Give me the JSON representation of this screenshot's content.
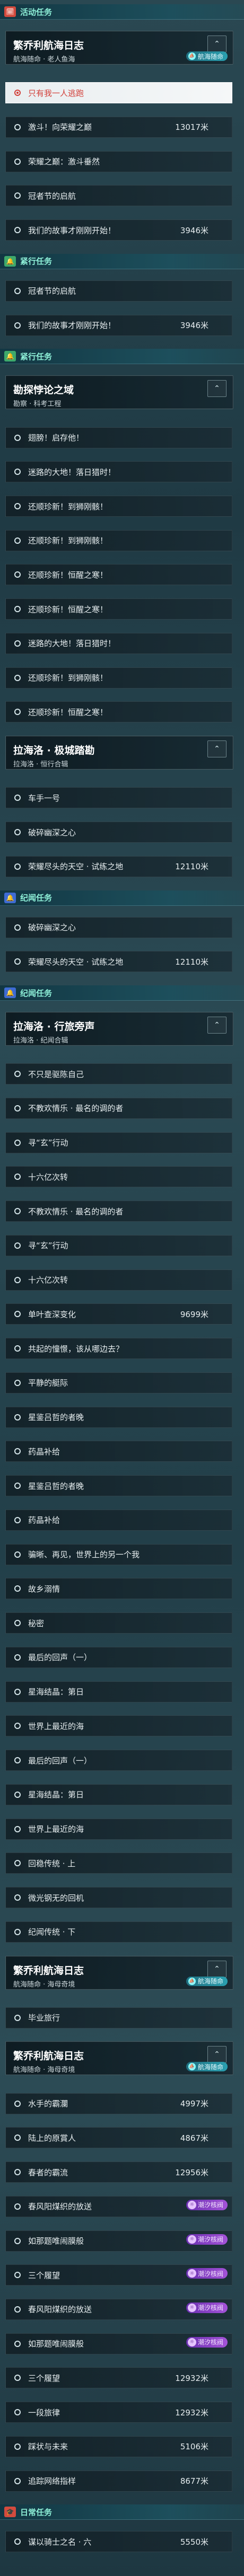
{
  "icons": {
    "activity": "calendar-icon",
    "urgent": "bell-icon",
    "chevron": "chevron-up-icon",
    "ring": "radio-ring-icon",
    "ferry": "ferry-icon",
    "dawn": "sunrise-icon"
  },
  "colors": {
    "activity_tag": "#d34b3e",
    "urgent_tag": "#3ea96b",
    "discipline_tag": "#3e6bd3",
    "selected_text": "#d2403a"
  },
  "items": [
    {
      "kind": "section",
      "icon_text": "🗓",
      "label": "活动任务",
      "tag": "activity"
    },
    {
      "kind": "card",
      "title": "繁乔利航海日志",
      "sub": "航海随命 · 老人鱼海",
      "chev": "⌃",
      "badge": "航海随命"
    },
    {
      "kind": "row",
      "title": "只有我一人逃跑",
      "selected": true
    },
    {
      "kind": "row",
      "title": "激斗！向荣耀之巅",
      "dist": "13017米"
    },
    {
      "kind": "row",
      "title": "荣耀之巅：激斗垂然"
    },
    {
      "kind": "row",
      "title": "冠者节的启航"
    },
    {
      "kind": "row",
      "title": "我们的故事才刚刚开始！",
      "dist": "3946米"
    },
    {
      "kind": "section",
      "icon_text": "🔔",
      "label": "紧行任务",
      "tag": "urgent"
    },
    {
      "kind": "row",
      "title": "冠者节的启航"
    },
    {
      "kind": "row",
      "title": "我们的故事才刚刚开始！",
      "dist": "3946米"
    },
    {
      "kind": "section",
      "icon_text": "🔔",
      "label": "紧行任务",
      "tag": "urgent"
    },
    {
      "kind": "card",
      "title": "勘探悖论之域",
      "sub": "勘察 · 科考工程",
      "chev": "⌃"
    },
    {
      "kind": "row",
      "title": "翅膀！启存他！"
    },
    {
      "kind": "row",
      "title": "迷路的大地！落日猎时！"
    },
    {
      "kind": "row",
      "title": "还顺珍新！到狮刚骸！"
    },
    {
      "kind": "row",
      "title": "还顺珍新！到狮刚骸！"
    },
    {
      "kind": "row",
      "title": "还顺珍新！恒醒之寒！"
    },
    {
      "kind": "row",
      "title": "还顺珍新！恒醒之寒！"
    },
    {
      "kind": "row",
      "title": "迷路的大地！落日猎时！"
    },
    {
      "kind": "row",
      "title": "还顺珍新！到狮刚骸！"
    },
    {
      "kind": "row",
      "title": "还顺珍新！恒醒之寒！"
    },
    {
      "kind": "card",
      "title": "拉海洛 · 极城踏勘",
      "sub": "拉海洛 · 恒行合辑",
      "chev": "⌃"
    },
    {
      "kind": "row",
      "title": "车手一号"
    },
    {
      "kind": "row",
      "title": "破碎幽深之心"
    },
    {
      "kind": "row",
      "title": "荣耀尽头的天空 · 试练之地",
      "dist": "12110米"
    },
    {
      "kind": "section",
      "icon_text": "🔔",
      "label": "纪闻任务",
      "tag": "discipline"
    },
    {
      "kind": "row",
      "title": "破碎幽深之心"
    },
    {
      "kind": "row",
      "title": "荣耀尽头的天空 · 试练之地",
      "dist": "12110米"
    },
    {
      "kind": "section",
      "icon_text": "🔔",
      "label": "纪闻任务",
      "tag": "discipline"
    },
    {
      "kind": "card",
      "title": "拉海洛 · 行旅旁声",
      "sub": "拉海洛 · 纪闻合辑",
      "chev": "⌃"
    },
    {
      "kind": "row",
      "title": "不只是驱陈自己"
    },
    {
      "kind": "row",
      "title": "不教欢情乐 · 最名的调的者"
    },
    {
      "kind": "row",
      "title": "寻“玄”行动"
    },
    {
      "kind": "row",
      "title": "十六亿次转"
    },
    {
      "kind": "row",
      "title": "不教欢情乐 · 最名的调的者"
    },
    {
      "kind": "row",
      "title": "寻“玄”行动"
    },
    {
      "kind": "row",
      "title": "十六亿次转"
    },
    {
      "kind": "row",
      "title": "单叶查深变化",
      "dist": "9699米"
    },
    {
      "kind": "row",
      "title": "共起的憧憬，该从哪边去？"
    },
    {
      "kind": "row",
      "title": "平静的艇际"
    },
    {
      "kind": "row",
      "title": "星鉴吕哲的者晚"
    },
    {
      "kind": "row",
      "title": "药晶补给"
    },
    {
      "kind": "row",
      "title": "星鉴吕哲的者晚"
    },
    {
      "kind": "row",
      "title": "药晶补给"
    },
    {
      "kind": "row",
      "title": "骗晰、再见，世界上的另一个我"
    },
    {
      "kind": "row",
      "title": "故乡溺情"
    },
    {
      "kind": "row",
      "title": "秘密"
    },
    {
      "kind": "row",
      "title": "最后的回声（一）"
    },
    {
      "kind": "row",
      "title": "星海结晶：第日"
    },
    {
      "kind": "row",
      "title": "世界上最近的海"
    },
    {
      "kind": "row",
      "title": "最后的回声（一）"
    },
    {
      "kind": "row",
      "title": "星海结晶：第日"
    },
    {
      "kind": "row",
      "title": "世界上最近的海"
    },
    {
      "kind": "row",
      "title": "回稳传统 · 上"
    },
    {
      "kind": "row",
      "title": "微光钢无的回机"
    },
    {
      "kind": "row",
      "title": "纪闻传统 · 下"
    },
    {
      "kind": "card",
      "title": "繁乔利航海日志",
      "sub": "航海随命 · 海母奇境",
      "chev": "⌃",
      "badge": "航海随命"
    },
    {
      "kind": "row",
      "title": "毕业旅行"
    },
    {
      "kind": "card",
      "title": "繁乔利航海日志",
      "sub": "航海随命 · 海母奇境",
      "chev": "⌃",
      "badge": "航海随命"
    },
    {
      "kind": "row",
      "title": "水手的霸瀾",
      "dist": "4997米"
    },
    {
      "kind": "row",
      "title": "陆上的原賞人",
      "dist": "4867米"
    },
    {
      "kind": "row",
      "title": "春者的霸流",
      "dist": "12956米"
    },
    {
      "kind": "row",
      "title": "春风阳煤织的放送",
      "pill": "潮汐核阀"
    },
    {
      "kind": "row",
      "title": "如那题唯闹膜般",
      "pill": "潮汐核阀"
    },
    {
      "kind": "row",
      "title": "三个履望",
      "pill": "潮汐核阀"
    },
    {
      "kind": "row",
      "title": "春风阳煤织的放送",
      "pill": "潮汐核阀"
    },
    {
      "kind": "row",
      "title": "如那题唯闹膜般",
      "pill": "潮汐核阀"
    },
    {
      "kind": "row",
      "title": "三个履望",
      "dist": "12932米"
    },
    {
      "kind": "row",
      "title": "一段旅律",
      "dist": "12932米"
    },
    {
      "kind": "row",
      "title": "踩状与未来",
      "dist": "5106米"
    },
    {
      "kind": "row",
      "title": "追踪网络指样",
      "dist": "8677米"
    },
    {
      "kind": "section",
      "icon_text": "🎓",
      "label": "日常任务",
      "tag": "activity"
    },
    {
      "kind": "row",
      "title": "谋以骑士之名 · 六",
      "dist": "5550米",
      "pill": ""
    }
  ]
}
